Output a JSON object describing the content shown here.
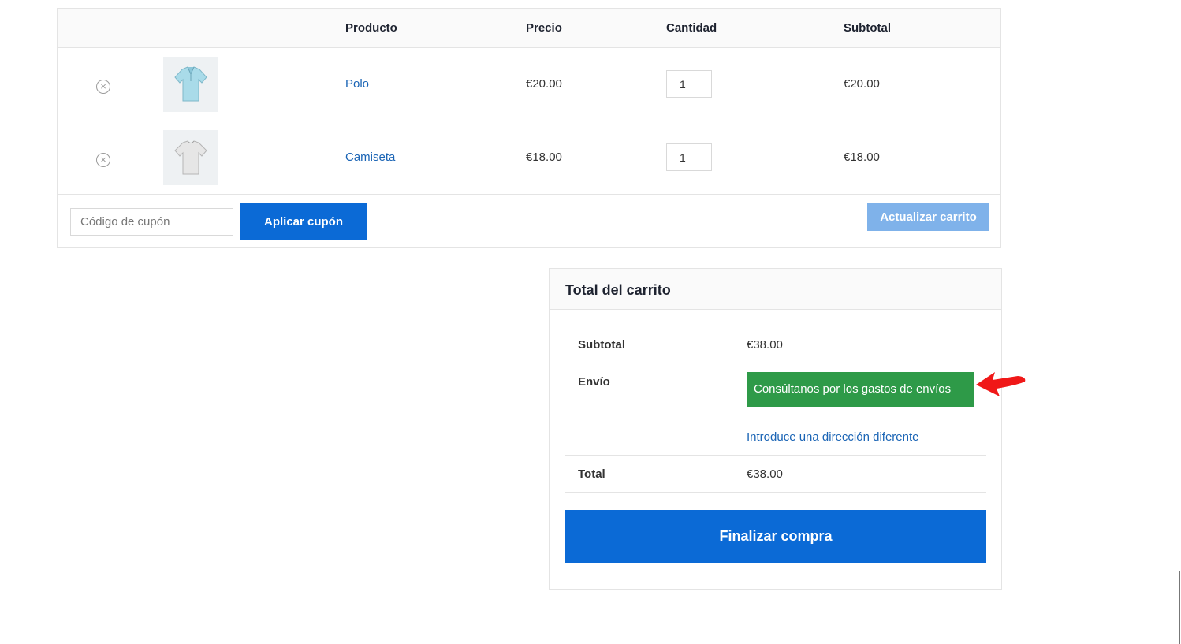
{
  "cart": {
    "headers": {
      "product": "Producto",
      "price": "Precio",
      "quantity": "Cantidad",
      "subtotal": "Subtotal"
    },
    "items": [
      {
        "name": "Polo",
        "price": "€20.00",
        "quantity": "1",
        "subtotal": "€20.00",
        "icon": "polo-shirt-thumbnail"
      },
      {
        "name": "Camiseta",
        "price": "€18.00",
        "quantity": "1",
        "subtotal": "€18.00",
        "icon": "t-shirt-thumbnail"
      }
    ],
    "remove_symbol": "×",
    "coupon_placeholder": "Código de cupón",
    "apply_coupon_label": "Aplicar cupón",
    "update_cart_label": "Actualizar carrito"
  },
  "totals": {
    "title": "Total del carrito",
    "subtotal_label": "Subtotal",
    "subtotal_value": "€38.00",
    "shipping_label": "Envío",
    "shipping_note": "Consúltanos por los gastos de envíos",
    "change_address_link": "Introduce una dirección diferente",
    "total_label": "Total",
    "total_value": "€38.00",
    "checkout_label": "Finalizar compra"
  },
  "colors": {
    "primary_button": "#0b6ad6",
    "disabled_button": "#7fb2ea",
    "shipping_note_bg": "#2e9a48",
    "link": "#1a64b5",
    "annotation_arrow": "#f01818"
  }
}
